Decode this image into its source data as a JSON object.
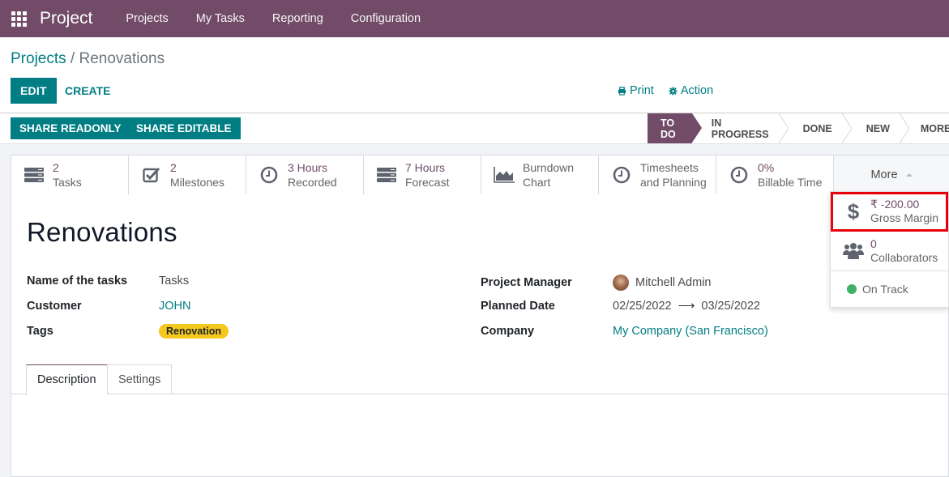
{
  "navbar": {
    "app_name": "Project",
    "menu": [
      "Projects",
      "My Tasks",
      "Reporting",
      "Configuration"
    ],
    "bg_color": "#714b67"
  },
  "breadcrumb": {
    "parent": "Projects",
    "separator": "/",
    "current": "Renovations"
  },
  "toolbar": {
    "edit_label": "EDIT",
    "create_label": "CREATE",
    "print_label": "Print",
    "action_label": "Action"
  },
  "statusbar": {
    "share_readonly": "SHARE READONLY",
    "share_editable": "SHARE EDITABLE",
    "stages": [
      "TO DO",
      "IN PROGRESS",
      "DONE",
      "NEW",
      "MORE"
    ],
    "active_stage": "TO DO"
  },
  "stat_buttons": [
    {
      "icon": "tasks-icon",
      "value": "2",
      "label": "Tasks"
    },
    {
      "icon": "checkbox-icon",
      "value": "2",
      "label": "Milestones"
    },
    {
      "icon": "clock-icon",
      "value": "3 Hours",
      "label": "Recorded"
    },
    {
      "icon": "tasks-icon",
      "value": "7 Hours",
      "label": "Forecast"
    },
    {
      "icon": "area-chart-icon",
      "value": "Burndown",
      "label": "Chart"
    },
    {
      "icon": "clock-icon",
      "value": "Timesheets",
      "label": "and Planning"
    },
    {
      "icon": "clock-icon",
      "value": "0%",
      "label": "Billable Time"
    }
  ],
  "more_button": {
    "label": "More",
    "dropdown": [
      {
        "icon": "dollar-icon",
        "value": "₹ -200.00",
        "label": "Gross Margin",
        "highlighted": true
      },
      {
        "icon": "users-icon",
        "value": "0",
        "label": "Collaborators"
      },
      {
        "icon": "status-dot",
        "label": "On Track",
        "color": "#3fb166"
      }
    ]
  },
  "record": {
    "title": "Renovations",
    "fields_left": [
      {
        "label": "Name of the tasks",
        "value": "Tasks"
      },
      {
        "label": "Customer",
        "value": "JOHN"
      },
      {
        "label": "Tags",
        "value": "Renovation"
      }
    ],
    "fields_right": [
      {
        "label": "Project Manager",
        "value": "Mitchell Admin"
      },
      {
        "label": "Planned Date",
        "start": "02/25/2022",
        "end": "03/25/2022"
      },
      {
        "label": "Company",
        "value": "My Company (San Francisco)"
      }
    ]
  },
  "tabs": [
    {
      "label": "Description",
      "active": true
    },
    {
      "label": "Settings",
      "active": false
    }
  ],
  "colors": {
    "primary": "#017e84",
    "brand": "#714b67",
    "tag": "#f4c81c",
    "highlight_border": "#e8000b"
  }
}
